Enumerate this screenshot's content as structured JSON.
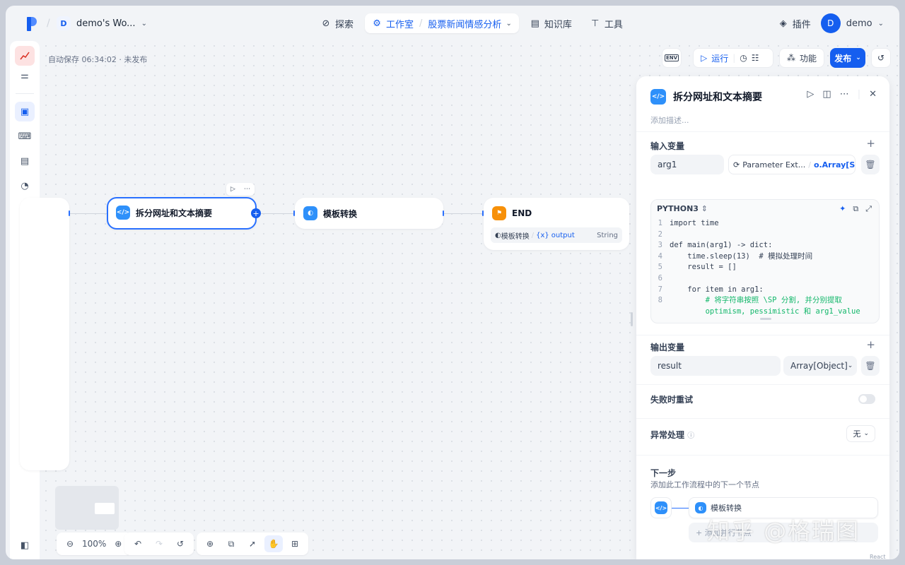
{
  "nav": {
    "workspace_initial": "D",
    "workspace_name": "demo's Wo...",
    "explore": "探索",
    "studio": "工作室",
    "app_name": "股票新闻情感分析",
    "knowledge": "知识库",
    "tools": "工具",
    "plugins": "插件",
    "user_initial": "D",
    "user_name": "demo"
  },
  "canvas": {
    "autosave": "自动保存 06:34:02 · 未发布",
    "toolbar": {
      "env": "ENV",
      "run": "运行",
      "features": "功能",
      "publish": "发布"
    },
    "nodes": {
      "code": {
        "title": "拆分网址和文本摘要"
      },
      "template": {
        "title": "模板转换"
      },
      "end": {
        "title": "END",
        "var_source": "模板转换",
        "var_name": "output",
        "var_type": "String"
      }
    },
    "zoom": "100%"
  },
  "panel": {
    "title": "拆分网址和文本摘要",
    "desc_placeholder": "添加描述...",
    "inputs_label": "输入变量",
    "input_name": "arg1",
    "input_ref_node": "Parameter Ext...",
    "input_ref_var": "o.Array[S...",
    "language": "PYTHON3",
    "code_lines": [
      {
        "n": "1",
        "t": "import time",
        "c": false
      },
      {
        "n": "2",
        "t": "",
        "c": false
      },
      {
        "n": "3",
        "t": "def main(arg1) -> dict:",
        "c": false
      },
      {
        "n": "4",
        "t": "    time.sleep(13)  # 模拟处理时间",
        "c": false
      },
      {
        "n": "5",
        "t": "    result = []",
        "c": false
      },
      {
        "n": "6",
        "t": "",
        "c": false
      },
      {
        "n": "7",
        "t": "    for item in arg1:",
        "c": false
      },
      {
        "n": "8",
        "t": "        # 将字符串按照 \\SP 分割, 并分别提取",
        "c": true
      },
      {
        "n": "",
        "t": "        optimism, pessimistic 和 arg1_value",
        "c": true
      }
    ],
    "outputs_label": "输出变量",
    "output_name": "result",
    "output_type": "Array[Object]",
    "retry_label": "失败时重试",
    "error_label": "异常处理",
    "error_value": "无",
    "next_label": "下一步",
    "next_sub": "添加此工作流程中的下一个节点",
    "next_node": "模板转换",
    "next_add": "+ 添加并行节点"
  },
  "watermark": "知乎 @格瑞图",
  "footer_brand": "React Flow",
  "colors": {
    "accent": "#155eef",
    "node_blue": "#2e90fa",
    "end_orange": "#f79009"
  }
}
